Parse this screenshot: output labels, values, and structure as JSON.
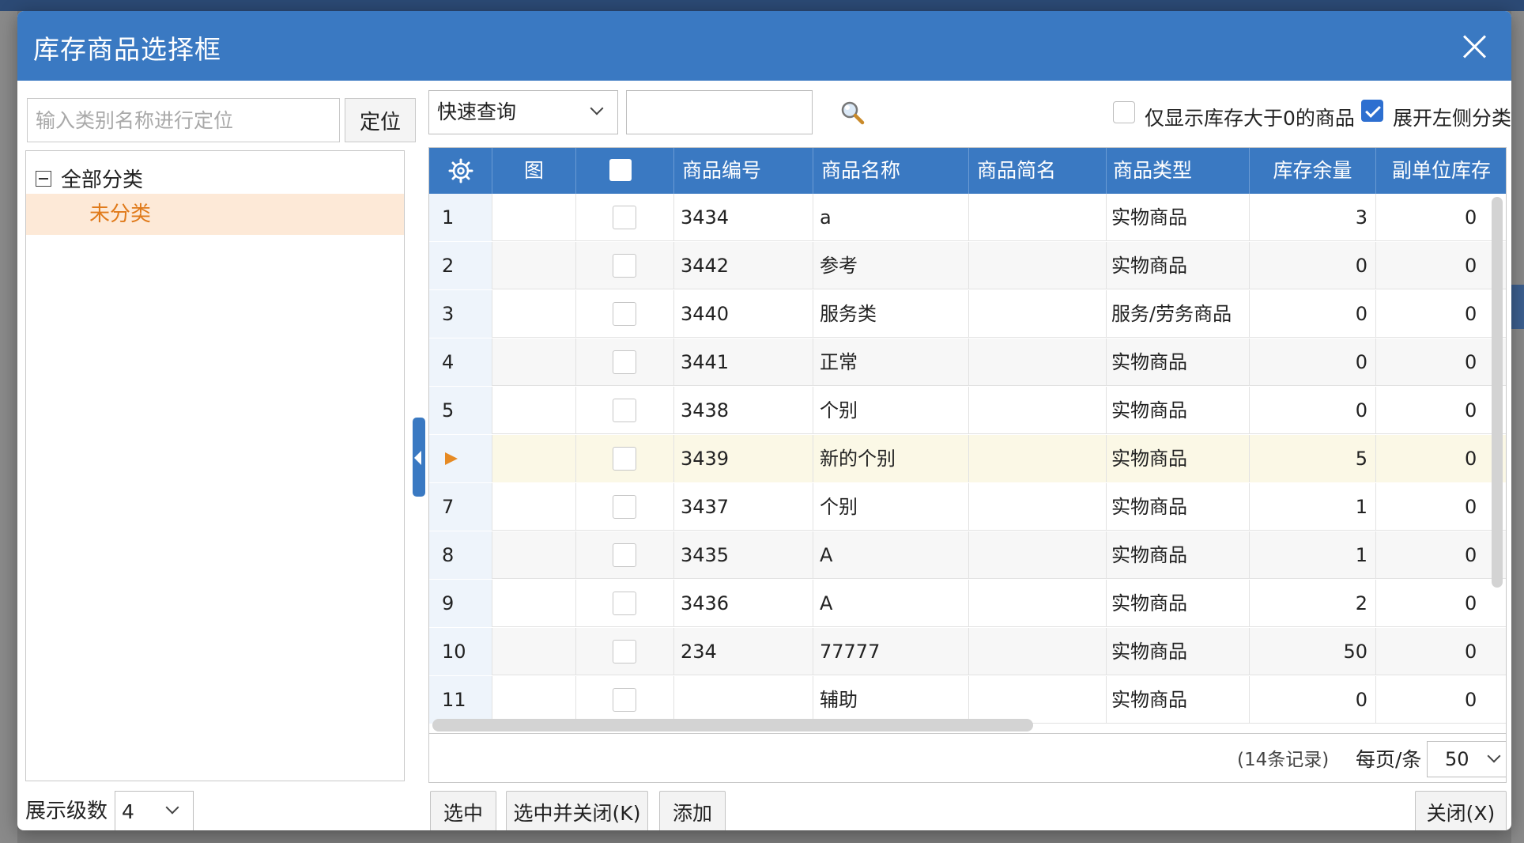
{
  "dialog": {
    "title": "库存商品选择框"
  },
  "left": {
    "search_placeholder": "输入类别名称进行定位",
    "locate_label": "定位",
    "tree_root": "全部分类",
    "tree_child": "未分类",
    "level_label": "展示级数",
    "level_value": "4"
  },
  "toolbar": {
    "query_select": "快速查询",
    "only_stock_label": "仅显示库存大于0的商品",
    "expand_left_label": "展开左侧分类"
  },
  "grid": {
    "columns": [
      "图",
      "商品编号",
      "商品名称",
      "商品简名",
      "商品类型",
      "库存余量",
      "副单位库存"
    ],
    "rows": [
      {
        "num": "1",
        "code": "3434",
        "name": "a",
        "short": "",
        "type": "实物商品",
        "stock": "3",
        "sub": "0"
      },
      {
        "num": "2",
        "code": "3442",
        "name": "参考",
        "short": "",
        "type": "实物商品",
        "stock": "0",
        "sub": "0"
      },
      {
        "num": "3",
        "code": "3440",
        "name": "服务类",
        "short": "",
        "type": "服务/劳务商品",
        "stock": "0",
        "sub": "0"
      },
      {
        "num": "4",
        "code": "3441",
        "name": "正常",
        "short": "",
        "type": "实物商品",
        "stock": "0",
        "sub": "0"
      },
      {
        "num": "5",
        "code": "3438",
        "name": "个别",
        "short": "",
        "type": "实物商品",
        "stock": "0",
        "sub": "0"
      },
      {
        "num": "",
        "code": "3439",
        "name": "新的个别",
        "short": "",
        "type": "实物商品",
        "stock": "5",
        "sub": "0"
      },
      {
        "num": "7",
        "code": "3437",
        "name": "个别",
        "short": "",
        "type": "实物商品",
        "stock": "1",
        "sub": "0"
      },
      {
        "num": "8",
        "code": "3435",
        "name": "A",
        "short": "",
        "type": "实物商品",
        "stock": "1",
        "sub": "0"
      },
      {
        "num": "9",
        "code": "3436",
        "name": "A",
        "short": "",
        "type": "实物商品",
        "stock": "2",
        "sub": "0"
      },
      {
        "num": "10",
        "code": "234",
        "name": "77777",
        "short": "",
        "type": "实物商品",
        "stock": "50",
        "sub": "0"
      },
      {
        "num": "11",
        "code": "",
        "name": "辅助",
        "short": "",
        "type": "实物商品",
        "stock": "0",
        "sub": "0"
      }
    ],
    "selected_row_index": 5,
    "records": "(14条记录)",
    "per_page_label": "每页/条",
    "per_page_value": "50"
  },
  "buttons": {
    "select": "选中",
    "select_close": "选中并关闭(K)",
    "add": "添加",
    "close": "关闭(X)"
  },
  "colors": {
    "header_blue": "#3a79c2",
    "selected_tree": "#fde9d7",
    "tree_child_text": "#e07a1a",
    "selected_row": "#fbf8e6",
    "row_arrow": "#e68a24"
  },
  "icons": {
    "close": "close-icon",
    "search": "magnifier-icon",
    "settings": "gear-icon",
    "collapse": "minus-box-icon"
  }
}
